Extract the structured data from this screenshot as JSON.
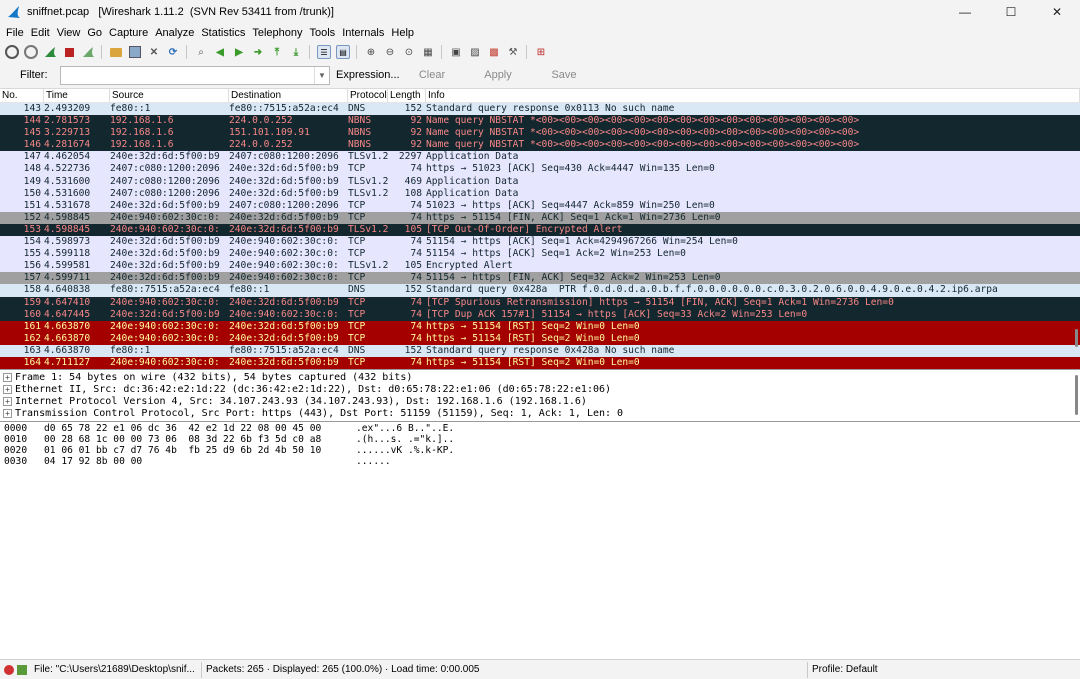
{
  "window": {
    "title": "sniffnet.pcap   [Wireshark 1.11.2  (SVN Rev 53411 from /trunk)]",
    "minimize": "—",
    "maximize": "☐",
    "close": "✕"
  },
  "menu": [
    "File",
    "Edit",
    "View",
    "Go",
    "Capture",
    "Analyze",
    "Statistics",
    "Telephony",
    "Tools",
    "Internals",
    "Help"
  ],
  "filter": {
    "label": "Filter:",
    "value": "",
    "expression": "Expression...",
    "clear": "Clear",
    "apply": "Apply",
    "save": "Save"
  },
  "columns": [
    "No.",
    "Time",
    "Source",
    "Destination",
    "Protocol",
    "Length",
    "Info"
  ],
  "packets": [
    {
      "no": "143",
      "time": "2.493209",
      "src": "fe80::1",
      "dst": "fe80::7515:a52a:ec4",
      "proto": "DNS",
      "len": "152",
      "info": "Standard query response 0x0113 No such name",
      "bg": "#dae8f5",
      "fg": "#12272e"
    },
    {
      "no": "144",
      "time": "2.781573",
      "src": "192.168.1.6",
      "dst": "224.0.0.252",
      "proto": "NBNS",
      "len": "92",
      "info": "Name query NBSTAT *<00><00><00><00><00><00><00><00><00><00><00><00><00><00>",
      "bg": "#12272e",
      "fg": "#f78787"
    },
    {
      "no": "145",
      "time": "3.229713",
      "src": "192.168.1.6",
      "dst": "151.101.109.91",
      "proto": "NBNS",
      "len": "92",
      "info": "Name query NBSTAT *<00><00><00><00><00><00><00><00><00><00><00><00><00><00>",
      "bg": "#12272e",
      "fg": "#f78787"
    },
    {
      "no": "146",
      "time": "4.281674",
      "src": "192.168.1.6",
      "dst": "224.0.0.252",
      "proto": "NBNS",
      "len": "92",
      "info": "Name query NBSTAT *<00><00><00><00><00><00><00><00><00><00><00><00><00><00>",
      "bg": "#12272e",
      "fg": "#f78787"
    },
    {
      "no": "147",
      "time": "4.462054",
      "src": "240e:32d:6d:5f00:b9",
      "dst": "2407:c080:1200:2096",
      "proto": "TLSv1.2",
      "len": "2297",
      "info": "Application Data",
      "bg": "#e7e6ff",
      "fg": "#12272e"
    },
    {
      "no": "148",
      "time": "4.522736",
      "src": "2407:c080:1200:2096",
      "dst": "240e:32d:6d:5f00:b9",
      "proto": "TCP",
      "len": "74",
      "info": "https → 51023 [ACK] Seq=430 Ack=4447 Win=135 Len=0",
      "bg": "#e7e6ff",
      "fg": "#12272e"
    },
    {
      "no": "149",
      "time": "4.531600",
      "src": "2407:c080:1200:2096",
      "dst": "240e:32d:6d:5f00:b9",
      "proto": "TLSv1.2",
      "len": "469",
      "info": "Application Data",
      "bg": "#e7e6ff",
      "fg": "#12272e"
    },
    {
      "no": "150",
      "time": "4.531600",
      "src": "2407:c080:1200:2096",
      "dst": "240e:32d:6d:5f00:b9",
      "proto": "TLSv1.2",
      "len": "108",
      "info": "Application Data",
      "bg": "#e7e6ff",
      "fg": "#12272e"
    },
    {
      "no": "151",
      "time": "4.531678",
      "src": "240e:32d:6d:5f00:b9",
      "dst": "2407:c080:1200:2096",
      "proto": "TCP",
      "len": "74",
      "info": "51023 → https [ACK] Seq=4447 Ack=859 Win=250 Len=0",
      "bg": "#e7e6ff",
      "fg": "#12272e"
    },
    {
      "no": "152",
      "time": "4.598845",
      "src": "240e:940:602:30c:0:",
      "dst": "240e:32d:6d:5f00:b9",
      "proto": "TCP",
      "len": "74",
      "info": "https → 51154 [FIN, ACK] Seq=1 Ack=1 Win=2736 Len=0",
      "bg": "#a0a0a0",
      "fg": "#12272e"
    },
    {
      "no": "153",
      "time": "4.598845",
      "src": "240e:940:602:30c:0:",
      "dst": "240e:32d:6d:5f00:b9",
      "proto": "TLSv1.2",
      "len": "105",
      "info": "[TCP Out-Of-Order] Encrypted Alert",
      "bg": "#12272e",
      "fg": "#f78787"
    },
    {
      "no": "154",
      "time": "4.598973",
      "src": "240e:32d:6d:5f00:b9",
      "dst": "240e:940:602:30c:0:",
      "proto": "TCP",
      "len": "74",
      "info": "51154 → https [ACK] Seq=1 Ack=4294967266 Win=254 Len=0",
      "bg": "#e7e6ff",
      "fg": "#12272e"
    },
    {
      "no": "155",
      "time": "4.599118",
      "src": "240e:32d:6d:5f00:b9",
      "dst": "240e:940:602:30c:0:",
      "proto": "TCP",
      "len": "74",
      "info": "51154 → https [ACK] Seq=1 Ack=2 Win=253 Len=0",
      "bg": "#e7e6ff",
      "fg": "#12272e"
    },
    {
      "no": "156",
      "time": "4.599581",
      "src": "240e:32d:6d:5f00:b9",
      "dst": "240e:940:602:30c:0:",
      "proto": "TLSv1.2",
      "len": "105",
      "info": "Encrypted Alert",
      "bg": "#e7e6ff",
      "fg": "#12272e"
    },
    {
      "no": "157",
      "time": "4.599711",
      "src": "240e:32d:6d:5f00:b9",
      "dst": "240e:940:602:30c:0:",
      "proto": "TCP",
      "len": "74",
      "info": "51154 → https [FIN, ACK] Seq=32 Ack=2 Win=253 Len=0",
      "bg": "#a0a0a0",
      "fg": "#12272e"
    },
    {
      "no": "158",
      "time": "4.640838",
      "src": "fe80::7515:a52a:ec4",
      "dst": "fe80::1",
      "proto": "DNS",
      "len": "152",
      "info": "Standard query 0x428a  PTR f.0.d.0.d.a.0.b.f.f.0.0.0.0.0.0.c.0.3.0.2.0.6.0.0.4.9.0.e.0.4.2.ip6.arpa",
      "bg": "#dae8f5",
      "fg": "#12272e"
    },
    {
      "no": "159",
      "time": "4.647410",
      "src": "240e:940:602:30c:0:",
      "dst": "240e:32d:6d:5f00:b9",
      "proto": "TCP",
      "len": "74",
      "info": "[TCP Spurious Retransmission] https → 51154 [FIN, ACK] Seq=1 Ack=1 Win=2736 Len=0",
      "bg": "#12272e",
      "fg": "#f78787"
    },
    {
      "no": "160",
      "time": "4.647445",
      "src": "240e:32d:6d:5f00:b9",
      "dst": "240e:940:602:30c:0:",
      "proto": "TCP",
      "len": "74",
      "info": "[TCP Dup ACK 157#1] 51154 → https [ACK] Seq=33 Ack=2 Win=253 Len=0",
      "bg": "#12272e",
      "fg": "#f78787"
    },
    {
      "no": "161",
      "time": "4.663870",
      "src": "240e:940:602:30c:0:",
      "dst": "240e:32d:6d:5f00:b9",
      "proto": "TCP",
      "len": "74",
      "info": "https → 51154 [RST] Seq=2 Win=0 Len=0",
      "bg": "#a40000",
      "fg": "#fffc9c"
    },
    {
      "no": "162",
      "time": "4.663870",
      "src": "240e:940:602:30c:0:",
      "dst": "240e:32d:6d:5f00:b9",
      "proto": "TCP",
      "len": "74",
      "info": "https → 51154 [RST] Seq=2 Win=0 Len=0",
      "bg": "#a40000",
      "fg": "#fffc9c"
    },
    {
      "no": "163",
      "time": "4.663870",
      "src": "fe80::1",
      "dst": "fe80::7515:a52a:ec4",
      "proto": "DNS",
      "len": "152",
      "info": "Standard query response 0x428a No such name",
      "bg": "#dae8f5",
      "fg": "#12272e"
    },
    {
      "no": "164",
      "time": "4.711127",
      "src": "240e:940:602:30c:0:",
      "dst": "240e:32d:6d:5f00:b9",
      "proto": "TCP",
      "len": "74",
      "info": "https → 51154 [RST] Seq=2 Win=0 Len=0",
      "bg": "#a40000",
      "fg": "#fffc9c"
    }
  ],
  "details": [
    "Frame 1: 54 bytes on wire (432 bits), 54 bytes captured (432 bits)",
    "Ethernet II, Src: dc:36:42:e2:1d:22 (dc:36:42:e2:1d:22), Dst: d0:65:78:22:e1:06 (d0:65:78:22:e1:06)",
    "Internet Protocol Version 4, Src: 34.107.243.93 (34.107.243.93), Dst: 192.168.1.6 (192.168.1.6)",
    "Transmission Control Protocol, Src Port: https (443), Dst Port: 51159 (51159), Seq: 1, Ack: 1, Len: 0"
  ],
  "hex": [
    {
      "off": "0000",
      "hex": "d0 65 78 22 e1 06 dc 36  42 e2 1d 22 08 00 45 00",
      "ascii": ".ex\"...6 B..\"..E."
    },
    {
      "off": "0010",
      "hex": "00 28 68 1c 00 00 73 06  08 3d 22 6b f3 5d c0 a8",
      "ascii": ".(h...s. .=\"k.]..",
      "ascii2": ""
    },
    {
      "off": "0020",
      "hex": "01 06 01 bb c7 d7 76 4b  fb 25 d9 6b 2d 4b 50 10",
      "ascii": "......vK .%.k-KP."
    },
    {
      "off": "0030",
      "hex": "04 17 92 8b 00 00",
      "ascii": "......"
    }
  ],
  "status": {
    "file": "File: \"C:\\Users\\21689\\Desktop\\snif...",
    "packets": "Packets: 265 · Displayed: 265 (100.0%) · Load time: 0:00.005",
    "profile": "Profile: Default"
  },
  "colors": {
    "chrome": "#f3f3f3",
    "dark_row": "#12272e",
    "rst_row": "#a40000",
    "tls_row": "#e7e6ff",
    "dns_row": "#dae8f5",
    "fin_row": "#a0a0a0"
  }
}
